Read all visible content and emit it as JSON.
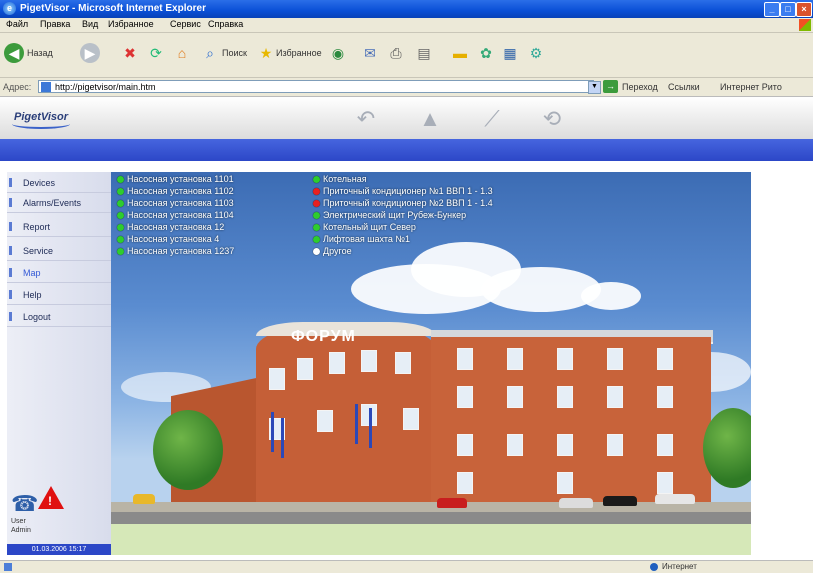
{
  "window": {
    "title": "PigetVisor - Microsoft Internet Explorer"
  },
  "menubar": {
    "items": [
      "Файл",
      "Правка",
      "Вид",
      "Избранное",
      "Сервис",
      "Справка"
    ]
  },
  "toolbar": {
    "back_label": "Назад",
    "search_label": "Поиск",
    "favorites_label": "Избранное"
  },
  "addressbar": {
    "label": "Адрес:",
    "url": "http://pigetvisor/main.htm",
    "go_label": "Переход",
    "links_label": "Ссылки",
    "extra_label": "Интернет Рито"
  },
  "app": {
    "logo": "PigetVisor",
    "header_icons": [
      "undo-icon",
      "tower-icon",
      "chart-icon",
      "history-icon"
    ]
  },
  "sidebar": {
    "items": [
      {
        "label": "Devices",
        "active": false
      },
      {
        "label": "Alarms/Events",
        "active": false
      },
      {
        "label": "Report",
        "active": false
      },
      {
        "label": "Service",
        "active": false
      },
      {
        "label": "Map",
        "active": true
      },
      {
        "label": "Help",
        "active": false
      },
      {
        "label": "Logout",
        "active": false
      }
    ],
    "note_line1": "User",
    "note_line2": "Admin",
    "datetime": "01.03.2006 15:17"
  },
  "map": {
    "building_label": "ФОРУМ",
    "status_col1": [
      {
        "label": "Насосная установка 1101",
        "state": "ok"
      },
      {
        "label": "Насосная установка 1102",
        "state": "ok"
      },
      {
        "label": "Насосная установка 1103",
        "state": "ok"
      },
      {
        "label": "Насосная установка 1104",
        "state": "ok"
      },
      {
        "label": "Насосная установка 12",
        "state": "ok"
      },
      {
        "label": "Насосная установка 4",
        "state": "ok"
      },
      {
        "label": "Насосная установка 1237",
        "state": "ok"
      }
    ],
    "status_col2": [
      {
        "label": "Котельная",
        "state": "ok"
      },
      {
        "label": "Приточный кондиционер №1 ВВП 1 - 1.3",
        "state": "alarm"
      },
      {
        "label": "Приточный кондиционер №2 ВВП 1 - 1.4",
        "state": "alarm"
      },
      {
        "label": "Электрический щит Рубеж-Бункер",
        "state": "ok"
      },
      {
        "label": "Котельный щит Север",
        "state": "ok"
      },
      {
        "label": "Лифтовая шахта №1",
        "state": "ok"
      },
      {
        "label": "Другое",
        "state": "none"
      }
    ]
  },
  "statusbar": {
    "zone": "Интернет"
  },
  "colors": {
    "accent": "#2c47c7",
    "ok": "#2ecc2e",
    "alarm": "#e82020",
    "facade": "#c8633a"
  }
}
